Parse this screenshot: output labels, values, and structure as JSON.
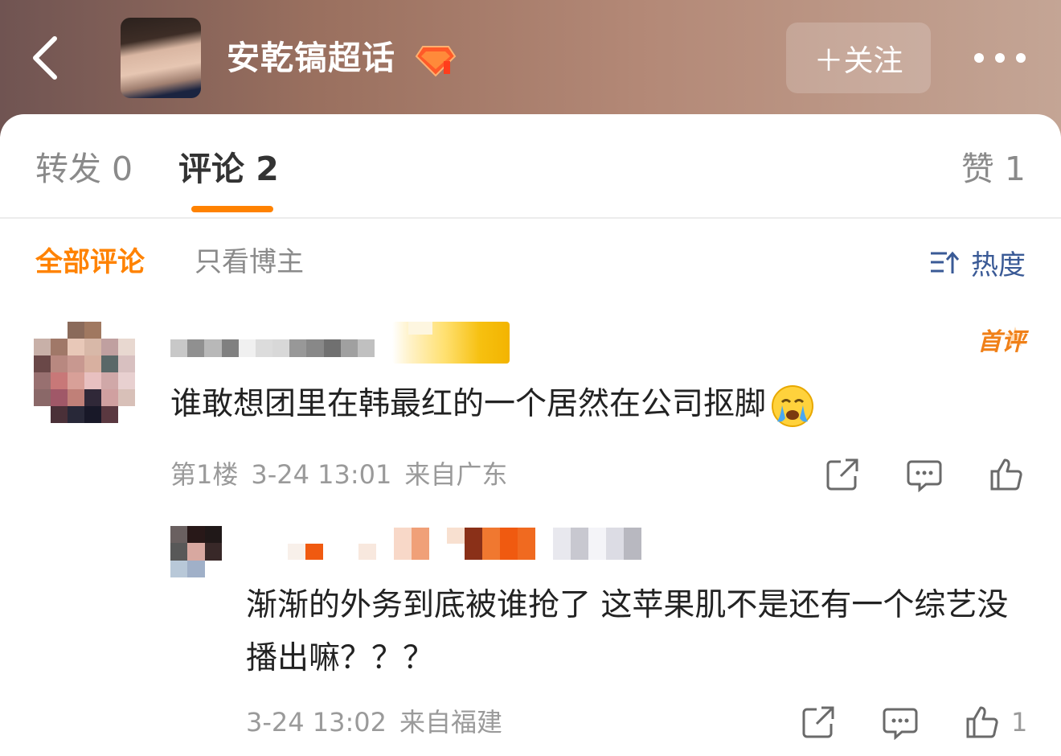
{
  "header": {
    "title": "安乾镐超话",
    "follow_label": "＋关注"
  },
  "tabs": {
    "repost": "转发 0",
    "comment": "评论 2",
    "like": "赞 1"
  },
  "filters": {
    "all": "全部评论",
    "blogger_only": "只看博主",
    "sort": "热度"
  },
  "comments": [
    {
      "badge": "首评",
      "text": "谁敢想团里在韩最红的一个居然在公司抠脚",
      "floor": "第1楼",
      "time": "3-24 13:01",
      "location": "来自广东"
    },
    {
      "text": "渐渐的外务到底被谁抢了 这苹果肌不是还有一个综艺没播出嘛？？？",
      "time": "3-24 13:02",
      "location": "来自福建",
      "like_count": "1"
    }
  ],
  "colors": {
    "accent": "#ff8200",
    "link_blue": "#3a5a96",
    "meta_gray": "#9a9a9a"
  }
}
